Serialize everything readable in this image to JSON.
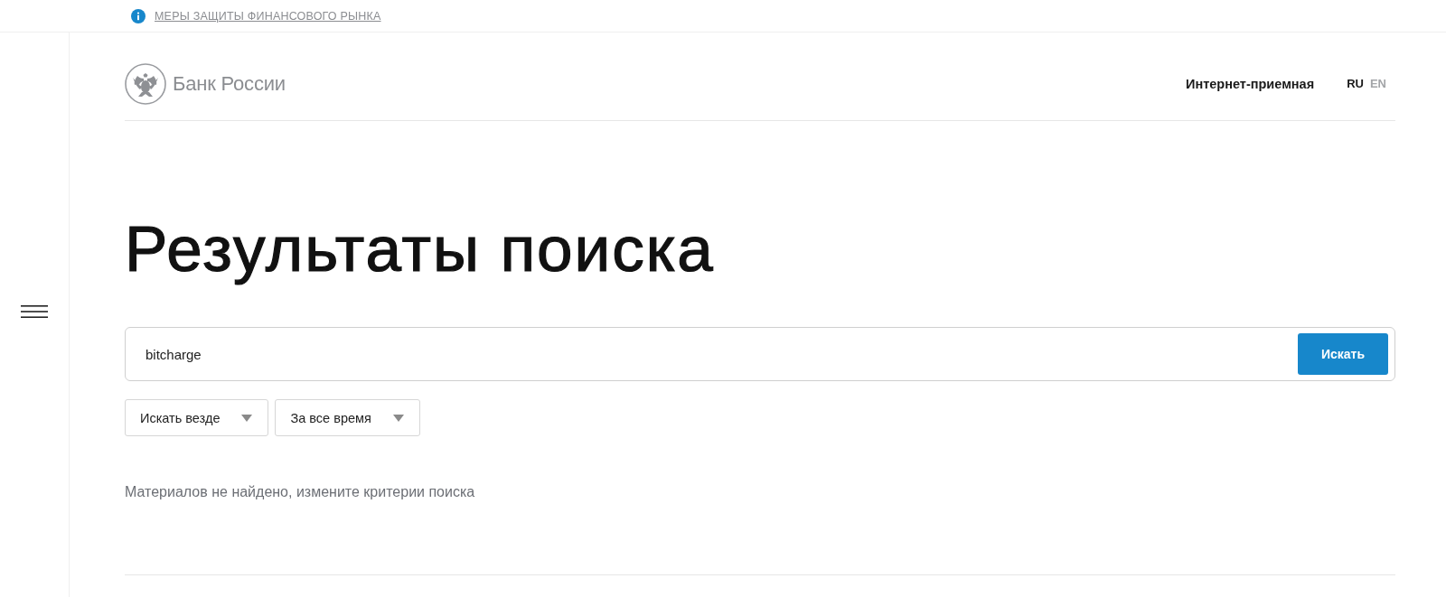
{
  "top_bar": {
    "notice_link": "МЕРЫ ЗАЩИТЫ ФИНАНСОВОГО РЫНКА"
  },
  "header": {
    "logo_text": "Банк России",
    "nav_link": "Интернет-приемная",
    "languages": [
      {
        "label": "RU",
        "selected": true
      },
      {
        "label": "EN",
        "selected": false
      }
    ]
  },
  "page_title": "Результаты поиска",
  "search": {
    "value": "bitcharge",
    "button": "Искать"
  },
  "filters": [
    {
      "value": "Искать везде"
    },
    {
      "value": "За все время"
    }
  ],
  "empty_message": "Материалов не найдено, измените критерии поиска"
}
